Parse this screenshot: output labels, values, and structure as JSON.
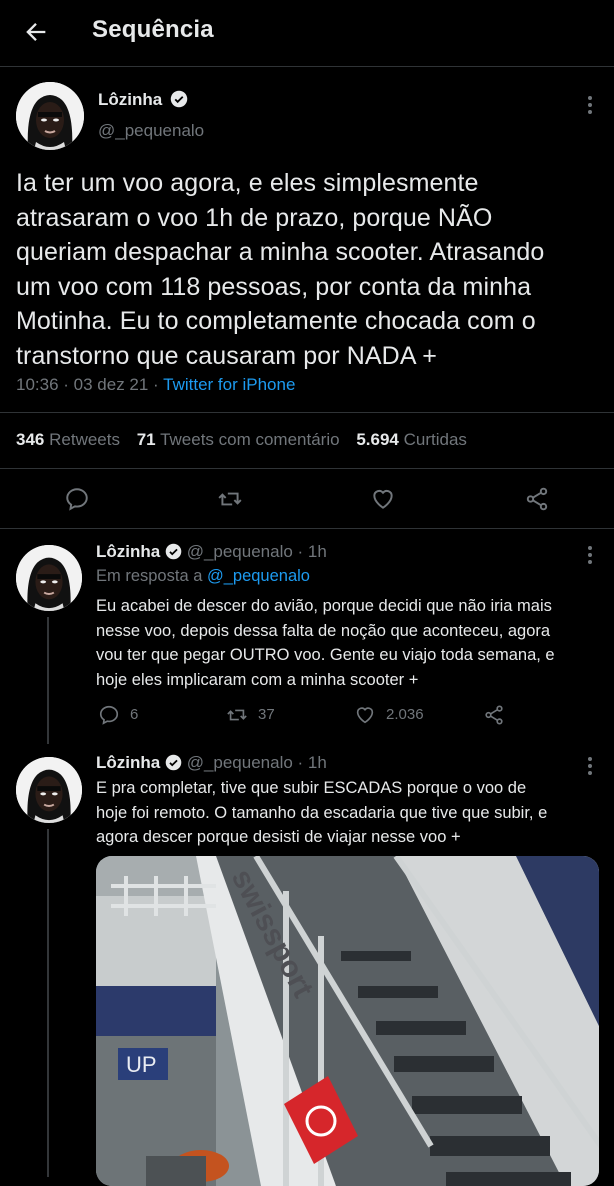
{
  "header": {
    "title": "Sequência",
    "back_icon": "arrow-left-icon"
  },
  "main_tweet": {
    "author_name": "Lôzinha",
    "author_handle": "@_pequenalo",
    "text_lines": [
      "Ia ter um voo agora, e eles simplesmente",
      "atrasaram o voo 1h de prazo, porque NÃO",
      "queriam despachar a minha scooter. Atrasando",
      "um voo com 118 pessoas, por conta da minha",
      "Motinha. Eu to completamente chocada com o",
      "transtorno que causaram por NADA +"
    ],
    "timestamp": "10:36 · 03 dez 21 · ",
    "source": "Twitter for iPhone",
    "stats": {
      "retweets_count": "346",
      "retweets_label": "Retweets",
      "quotes_count": "71",
      "quotes_label": "Tweets com comentário",
      "likes_count": "5.694",
      "likes_label": "Curtidas"
    }
  },
  "replies": [
    {
      "author_name": "Lôzinha",
      "author_handle": "@_pequenalo",
      "time": " · 1h",
      "reply_to_prefix": "Em resposta a ",
      "reply_to_handle": "@_pequenalo",
      "text_lines": [
        "Eu acabei de descer do avião, porque decidi que não iria mais",
        "nesse voo, depois dessa falta de noção que aconteceu, agora",
        "vou ter que pegar OUTRO voo. Gente eu viajo toda semana, e",
        "hoje eles implicaram com a minha scooter +"
      ],
      "replies_count": "6",
      "retweets_count": "37",
      "likes_count": "2.036"
    },
    {
      "author_name": "Lôzinha",
      "author_handle": "@_pequenalo",
      "time": " · 1h",
      "text_lines": [
        "E pra completar, tive que subir ESCADAS porque o voo de",
        "hoje foi remoto. O tamanho da escadaria que tive que subir, e",
        "agora descer porque desisti de viajar nesse voo +"
      ],
      "photo_text_brand": "swissport",
      "photo_text_up": "UP"
    }
  ],
  "colors": {
    "background": "#000000",
    "text": "#e7e9ea",
    "muted": "#71767b",
    "link": "#1d9bf0",
    "divider": "#2f3336"
  }
}
